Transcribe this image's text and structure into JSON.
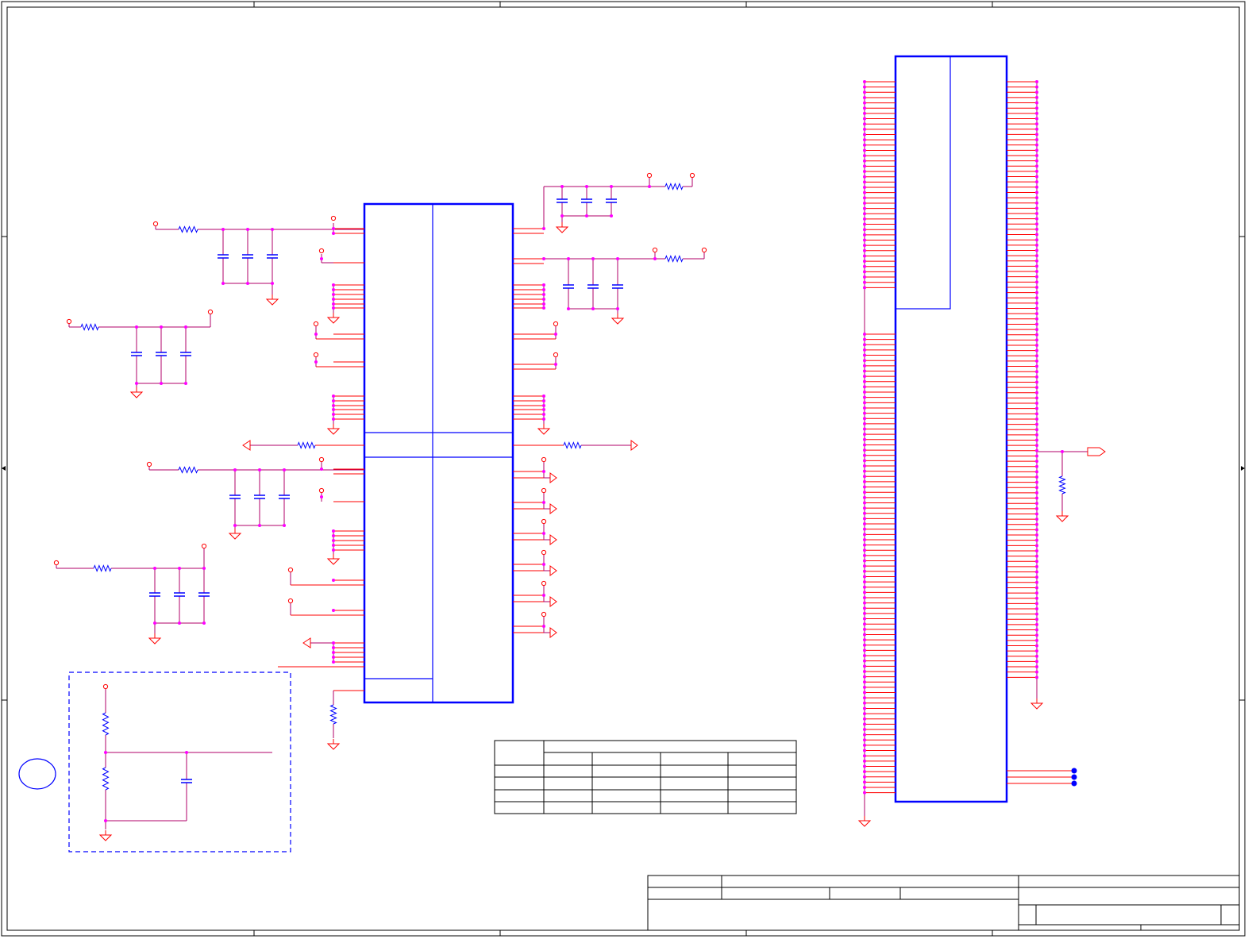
{
  "palette": {
    "wire": "#b0006a",
    "pin": "#ff0000",
    "power": "#ff0000",
    "part": "#0000ff",
    "junction": "#ff00ff",
    "frame": "#000000",
    "background": "#ffffff"
  },
  "sheet": {
    "size": "1572x1183",
    "text_visible": false
  }
}
